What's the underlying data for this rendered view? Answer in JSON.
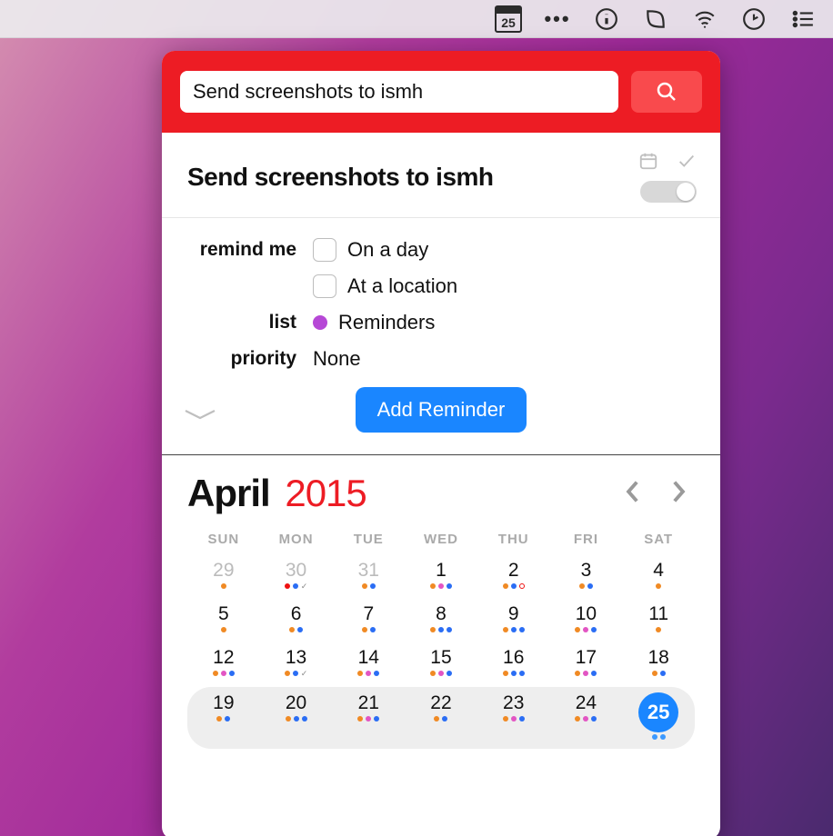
{
  "menubar": {
    "calendar_day": "25"
  },
  "header": {
    "input_value": "Send screenshots to ismh"
  },
  "reminder": {
    "title": "Send screenshots to ismh",
    "labels": {
      "remind": "remind me",
      "list": "list",
      "priority": "priority"
    },
    "on_day": "On a day",
    "at_location": "At a location",
    "list_name": "Reminders",
    "priority_value": "None",
    "add_button": "Add Reminder"
  },
  "calendar": {
    "month": "April",
    "year": "2015",
    "dow": [
      "SUN",
      "MON",
      "TUE",
      "WED",
      "THU",
      "FRI",
      "SAT"
    ],
    "weeks": [
      [
        {
          "n": "29",
          "other": true,
          "dots": [
            "or"
          ]
        },
        {
          "n": "30",
          "other": true,
          "dots": [
            "rd",
            "bl",
            "ck"
          ]
        },
        {
          "n": "31",
          "other": true,
          "dots": [
            "or",
            "bl"
          ]
        },
        {
          "n": "1",
          "dots": [
            "or",
            "pk",
            "bl"
          ]
        },
        {
          "n": "2",
          "dots": [
            "or",
            "bl",
            "ring"
          ]
        },
        {
          "n": "3",
          "dots": [
            "or",
            "bl"
          ]
        },
        {
          "n": "4",
          "dots": [
            "or"
          ]
        }
      ],
      [
        {
          "n": "5",
          "dots": [
            "or"
          ]
        },
        {
          "n": "6",
          "dots": [
            "or",
            "bl"
          ]
        },
        {
          "n": "7",
          "dots": [
            "or",
            "bl"
          ]
        },
        {
          "n": "8",
          "dots": [
            "or",
            "bl",
            "bl"
          ]
        },
        {
          "n": "9",
          "dots": [
            "or",
            "bl",
            "bl"
          ]
        },
        {
          "n": "10",
          "dots": [
            "or",
            "pk",
            "bl"
          ]
        },
        {
          "n": "11",
          "dots": [
            "or"
          ]
        }
      ],
      [
        {
          "n": "12",
          "dots": [
            "or",
            "pk",
            "bl"
          ]
        },
        {
          "n": "13",
          "dots": [
            "or",
            "bl",
            "ck"
          ]
        },
        {
          "n": "14",
          "dots": [
            "or",
            "pk",
            "bl"
          ]
        },
        {
          "n": "15",
          "dots": [
            "or",
            "pk",
            "bl"
          ]
        },
        {
          "n": "16",
          "dots": [
            "or",
            "bl",
            "bl"
          ]
        },
        {
          "n": "17",
          "dots": [
            "or",
            "pk",
            "bl"
          ]
        },
        {
          "n": "18",
          "dots": [
            "or",
            "bl"
          ]
        }
      ],
      [
        {
          "n": "19",
          "dots": [
            "or",
            "bl"
          ]
        },
        {
          "n": "20",
          "dots": [
            "or",
            "bl",
            "bl"
          ]
        },
        {
          "n": "21",
          "dots": [
            "or",
            "pk",
            "bl"
          ]
        },
        {
          "n": "22",
          "dots": [
            "or",
            "bl"
          ]
        },
        {
          "n": "23",
          "dots": [
            "or",
            "pk",
            "bl"
          ]
        },
        {
          "n": "24",
          "dots": [
            "or",
            "pk",
            "bl"
          ]
        },
        {
          "n": "25",
          "today": true,
          "dots": [
            "bl",
            "bl"
          ]
        }
      ]
    ]
  }
}
